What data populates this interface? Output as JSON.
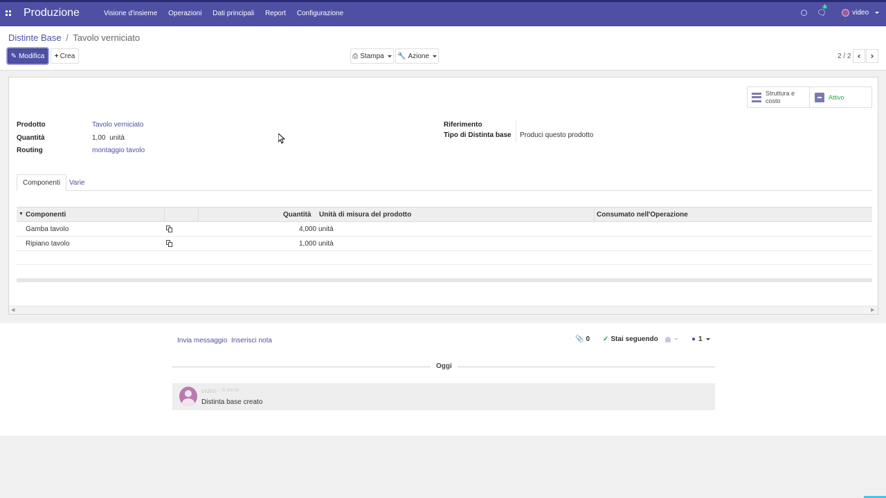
{
  "topbar": {
    "app_name": "Produzione",
    "menu": [
      "Visione d'insieme",
      "Operazioni",
      "Dati principali",
      "Report",
      "Configurazione"
    ],
    "chat_count": "1",
    "user": "video"
  },
  "breadcrumb": {
    "parent": "Distinte Base",
    "separator": "/",
    "current": "Tavolo verniciato"
  },
  "toolbar": {
    "edit_label": "Modifica",
    "create_label": "Crea",
    "print_label": "Stampa",
    "action_label": "Azione",
    "pager": "2 / 2"
  },
  "smart_buttons": {
    "structure": "Struttura e costo",
    "active": "Attivo"
  },
  "form": {
    "product_label": "Prodotto",
    "product_value": "Tavolo verniciato",
    "quantity_label": "Quantità",
    "quantity_value": "1,00",
    "quantity_unit": "unità",
    "routing_label": "Routing",
    "routing_value": "montaggio tavolo",
    "reference_label": "Riferimento",
    "reference_value": "",
    "bom_type_label": "Tipo di Distinta base",
    "bom_type_value": "Produci questo prodotto"
  },
  "tabs": [
    "Componenti",
    "Varie"
  ],
  "table": {
    "headers": {
      "component": "Componenti",
      "quantity": "Quantità",
      "uom": "Unità di misura del prodotto",
      "operation": "Consumato nell'Operazione"
    },
    "rows": [
      {
        "component": "Gamba tavolo",
        "quantity": "4,000",
        "uom": "unità",
        "operation": ""
      },
      {
        "component": "Ripiano tavolo",
        "quantity": "1,000",
        "uom": "unità",
        "operation": ""
      }
    ]
  },
  "chatter": {
    "send_message": "Invia messaggio",
    "log_note": "Inserisci nota",
    "attachments": "0",
    "following": "Stai seguendo",
    "followers": "1",
    "today": "Oggi",
    "message": {
      "author": "video",
      "time": "- 5 ore fa",
      "body": "Distinta base creato"
    }
  },
  "colors": {
    "brand": "#4f4fa3",
    "success": "#28a745"
  }
}
